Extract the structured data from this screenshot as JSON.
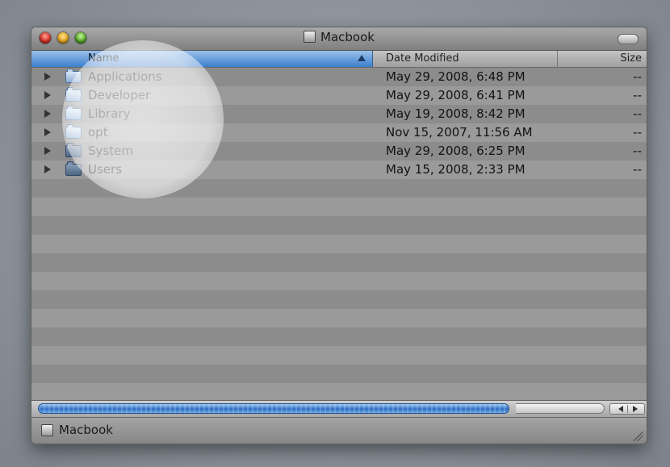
{
  "window": {
    "title": "Macbook",
    "icon": "hard-disk-icon"
  },
  "columns": {
    "name": "Name",
    "date_modified": "Date Modified",
    "size": "Size",
    "sort_icon": "sort-ascending-icon"
  },
  "rows": [
    {
      "name": "Applications",
      "date": "May 29, 2008, 6:48 PM",
      "size": "--",
      "icon": "applications-folder-icon"
    },
    {
      "name": "Developer",
      "date": "May 29, 2008, 6:41 PM",
      "size": "--",
      "icon": "developer-folder-icon"
    },
    {
      "name": "Library",
      "date": "May 19, 2008, 8:42 PM",
      "size": "--",
      "icon": "library-folder-icon"
    },
    {
      "name": "opt",
      "date": "Nov 15, 2007, 11:56 AM",
      "size": "--",
      "icon": "folder-icon"
    },
    {
      "name": "System",
      "date": "May 29, 2008, 6:25 PM",
      "size": "--",
      "icon": "system-folder-icon"
    },
    {
      "name": "Users",
      "date": "May 15, 2008, 2:33 PM",
      "size": "--",
      "icon": "users-folder-icon"
    }
  ],
  "footer": {
    "path_label": "Macbook"
  },
  "colors": {
    "selection_blue": "#3c7fcd",
    "row_gray": "#8c8c8c",
    "row_gray_alt": "#9a9a9a",
    "close": "#d32a1d",
    "minimize": "#e0a017",
    "zoom": "#4fa41f"
  }
}
